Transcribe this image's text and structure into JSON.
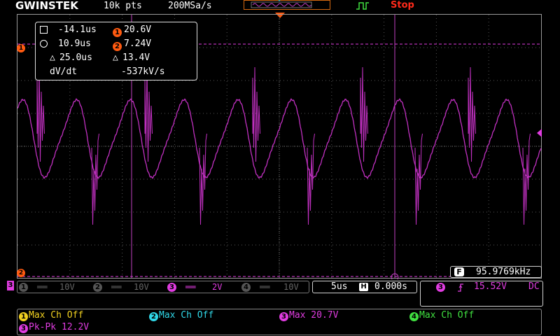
{
  "header": {
    "brand": "GWINSTEK",
    "record_length": "10k pts",
    "sample_rate": "200MSa/s",
    "run_state": "Stop"
  },
  "cursors": {
    "h1_time": "-14.1us",
    "h2_time": "10.9us",
    "delta_time": "25.0us",
    "v1_value": "20.6V",
    "v2_value": "7.24V",
    "delta_value": "13.4V",
    "dvdt_label": "dV/dt",
    "dvdt_value": "-537kV/s",
    "v1_marker": "1",
    "v2_marker": "2"
  },
  "frequency": {
    "badge": "F",
    "value": "95.9769kHz"
  },
  "channels": [
    {
      "num": "1",
      "coupling": "══",
      "scale": "10V",
      "active": false,
      "color": "#666666"
    },
    {
      "num": "2",
      "coupling": "══",
      "scale": "10V",
      "active": false,
      "color": "#666666"
    },
    {
      "num": "3",
      "coupling": "══",
      "scale": "2V",
      "active": true,
      "color": "#e03ce0"
    },
    {
      "num": "4",
      "coupling": "══",
      "scale": "10V",
      "active": false,
      "color": "#666666"
    }
  ],
  "timebase": {
    "scale": "5us",
    "h_badge": "H",
    "position": "0.000s"
  },
  "trigger": {
    "source": "3",
    "level": "15.52V",
    "coupling": "DC"
  },
  "measurements": [
    {
      "num": "1",
      "text": "Max Ch Off",
      "color": "#f0d020"
    },
    {
      "num": "2",
      "text": "Max Ch Off",
      "color": "#30d8e8"
    },
    {
      "num": "3",
      "text": "Max 20.7V",
      "color": "#e03ce0"
    },
    {
      "num": "4",
      "text": "Max Ch Off",
      "color": "#40e040"
    },
    {
      "num": "3",
      "text": "Pk-Pk 12.2V",
      "color": "#e03ce0"
    }
  ],
  "colors": {
    "ch1": "#f0d020",
    "ch2": "#30d8e8",
    "ch3": "#e03ce0",
    "ch4": "#40e040",
    "accent": "#ff5a10",
    "stop": "#ff2a1a"
  },
  "left_markers": {
    "ch1": "1",
    "ch2": "2",
    "ch3": "3"
  }
}
